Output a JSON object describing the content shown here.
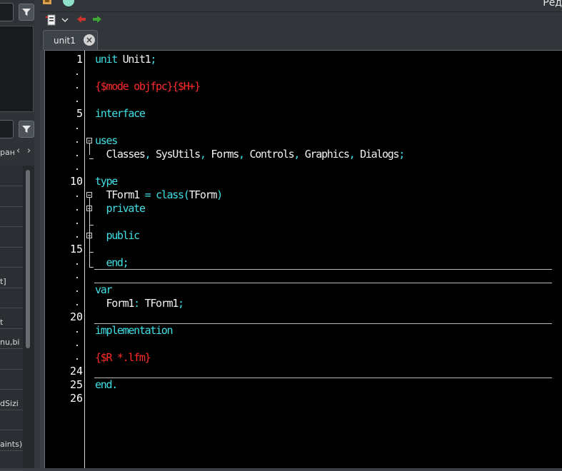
{
  "window": {
    "title_fragment": "Ред"
  },
  "left_panel": {
    "tab_fragment": "ран",
    "prev_arrow": "‹",
    "next_arrow": "›",
    "grid_rows": [
      "",
      "",
      "",
      "",
      "",
      "t]",
      "",
      "t",
      "nu,bi",
      "",
      "",
      "dSizi",
      "",
      "aints)",
      ""
    ]
  },
  "toolbar": {
    "icons": [
      "form-toggle-icon",
      "dropdown-chevron-icon",
      "back-arrow-icon",
      "forward-arrow-icon"
    ]
  },
  "tabs": [
    {
      "label": "unit1",
      "close": "×"
    }
  ],
  "editor": {
    "line_numbers": [
      {
        "text": "1",
        "row": 0
      },
      {
        "text": ".",
        "row": 1
      },
      {
        "text": ".",
        "row": 2
      },
      {
        "text": ".",
        "row": 3
      },
      {
        "text": "5",
        "row": 4
      },
      {
        "text": ".",
        "row": 5
      },
      {
        "text": ".",
        "row": 6
      },
      {
        "text": ".",
        "row": 7
      },
      {
        "text": ".",
        "row": 8
      },
      {
        "text": "10",
        "row": 9
      },
      {
        "text": ".",
        "row": 10
      },
      {
        "text": ".",
        "row": 11
      },
      {
        "text": ".",
        "row": 12
      },
      {
        "text": ".",
        "row": 13
      },
      {
        "text": "15",
        "row": 14
      },
      {
        "text": ".",
        "row": 15
      },
      {
        "text": ".",
        "row": 16
      },
      {
        "text": ".",
        "row": 17
      },
      {
        "text": ".",
        "row": 18
      },
      {
        "text": "20",
        "row": 19
      },
      {
        "text": ".",
        "row": 20
      },
      {
        "text": ".",
        "row": 21
      },
      {
        "text": ".",
        "row": 22
      },
      {
        "text": "24",
        "row": 23
      },
      {
        "text": "25",
        "row": 24
      },
      {
        "text": "26",
        "row": 25
      }
    ],
    "lines": [
      {
        "row": 0,
        "tokens": [
          {
            "t": "unit",
            "c": "kw"
          },
          {
            "t": " Unit1",
            "c": "id"
          },
          {
            "t": ";",
            "c": "sym"
          }
        ]
      },
      {
        "row": 2,
        "tokens": [
          {
            "t": "{$mode objfpc}{$H+}",
            "c": "dir"
          }
        ]
      },
      {
        "row": 4,
        "tokens": [
          {
            "t": "interface",
            "c": "kw"
          }
        ]
      },
      {
        "row": 6,
        "tokens": [
          {
            "t": "uses",
            "c": "kw"
          }
        ]
      },
      {
        "row": 7,
        "tokens": [
          {
            "t": "  Classes",
            "c": "id"
          },
          {
            "t": ",",
            "c": "sym"
          },
          {
            "t": " SysUtils",
            "c": "id"
          },
          {
            "t": ",",
            "c": "sym"
          },
          {
            "t": " Forms",
            "c": "id"
          },
          {
            "t": ",",
            "c": "sym"
          },
          {
            "t": " Controls",
            "c": "id"
          },
          {
            "t": ",",
            "c": "sym"
          },
          {
            "t": " Graphics",
            "c": "id"
          },
          {
            "t": ",",
            "c": "sym"
          },
          {
            "t": " Dialogs",
            "c": "id"
          },
          {
            "t": ";",
            "c": "sym"
          }
        ]
      },
      {
        "row": 9,
        "tokens": [
          {
            "t": "type",
            "c": "kw"
          }
        ]
      },
      {
        "row": 10,
        "tokens": [
          {
            "t": "  TForm1",
            "c": "id"
          },
          {
            "t": " = ",
            "c": "sym"
          },
          {
            "t": "class",
            "c": "kw"
          },
          {
            "t": "(",
            "c": "sym"
          },
          {
            "t": "TForm",
            "c": "id"
          },
          {
            "t": ")",
            "c": "sym"
          }
        ]
      },
      {
        "row": 11,
        "tokens": [
          {
            "t": "  private",
            "c": "kw"
          }
        ]
      },
      {
        "row": 13,
        "tokens": [
          {
            "t": "  public",
            "c": "kw"
          }
        ]
      },
      {
        "row": 15,
        "tokens": [
          {
            "t": "  end",
            "c": "kw"
          },
          {
            "t": ";",
            "c": "sym"
          }
        ]
      },
      {
        "row": 17,
        "tokens": [
          {
            "t": "var",
            "c": "kw"
          }
        ]
      },
      {
        "row": 18,
        "tokens": [
          {
            "t": "  Form1",
            "c": "id"
          },
          {
            "t": ": ",
            "c": "sym"
          },
          {
            "t": "TForm1",
            "c": "id"
          },
          {
            "t": ";",
            "c": "sym"
          }
        ]
      },
      {
        "row": 20,
        "tokens": [
          {
            "t": "implementation",
            "c": "kw"
          }
        ]
      },
      {
        "row": 22,
        "tokens": [
          {
            "t": "{$R *.lfm}",
            "c": "dir"
          }
        ]
      },
      {
        "row": 24,
        "tokens": [
          {
            "t": "end",
            "c": "kw"
          },
          {
            "t": ".",
            "c": "sym"
          }
        ]
      }
    ],
    "dividers_after_rows": [
      15,
      16,
      19,
      23
    ],
    "fold_markers": [
      6,
      10,
      11,
      13
    ]
  }
}
